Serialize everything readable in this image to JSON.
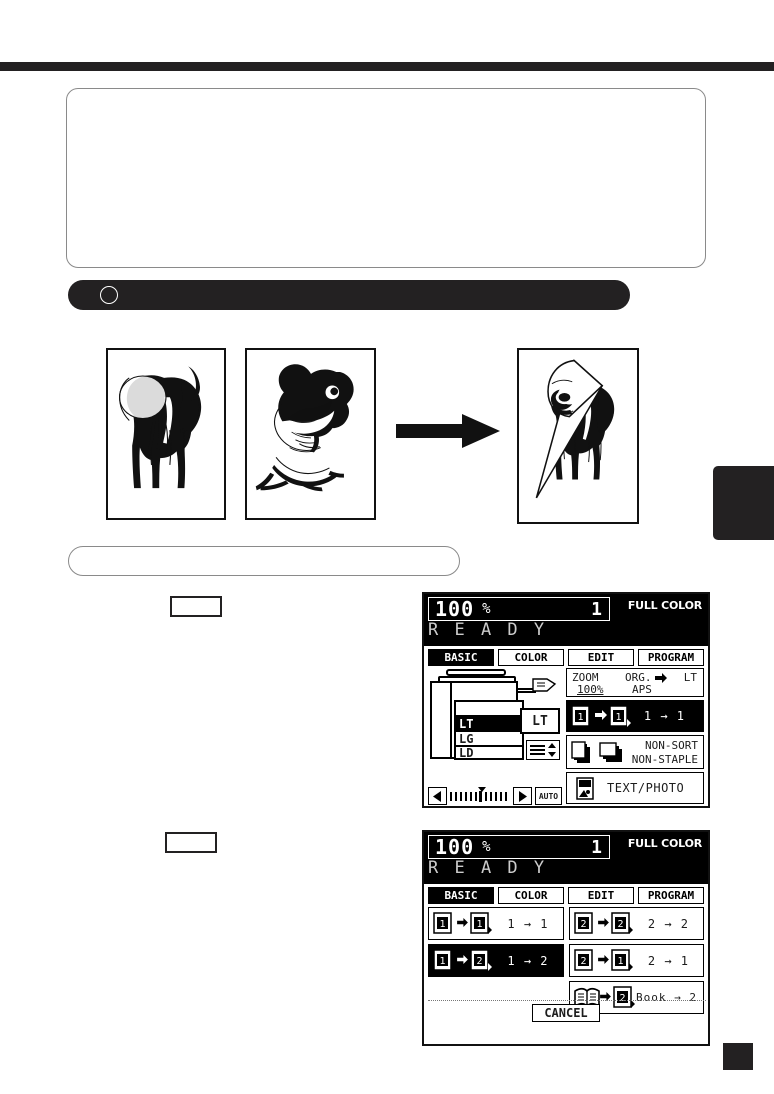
{
  "page": {
    "side_tab": "",
    "corner_marker": "",
    "intro_note": "",
    "section_heading": "",
    "procedure_heading": "",
    "step1_number": "",
    "step2_number": ""
  },
  "illustration": {
    "original_1": "elephant-original",
    "original_2": "dog-original",
    "arrow": "right-arrow",
    "result": "two-sided-copy-result"
  },
  "panel1": {
    "header": {
      "zoom_percent": "100",
      "percent_symbol": "%",
      "copies": "1",
      "color_mode": "FULL COLOR",
      "status": "R E A D Y"
    },
    "tabs": [
      {
        "label": "BASIC",
        "selected": true
      },
      {
        "label": "COLOR",
        "selected": false
      },
      {
        "label": "EDIT",
        "selected": false
      },
      {
        "label": "PROGRAM",
        "selected": false
      }
    ],
    "cassettes": [
      {
        "label": "",
        "selected": false
      },
      {
        "label": "LT",
        "selected": true
      },
      {
        "label": "LG",
        "selected": false
      },
      {
        "label": "LD",
        "selected": false
      }
    ],
    "current_paper": "LT",
    "density": {
      "auto_label": "AUTO"
    },
    "zoom_box": {
      "zoom_label": "ZOOM",
      "zoom_value": "100%",
      "org_label": "ORG.",
      "aps_label": "APS",
      "paper_label": "LT"
    },
    "duplex_button": {
      "label": "1 → 1",
      "selected": true
    },
    "finishing_button": {
      "line1": "NON-SORT",
      "line2": "NON-STAPLE"
    },
    "original_mode_button": {
      "label": "TEXT/PHOTO"
    }
  },
  "panel2": {
    "header": {
      "zoom_percent": "100",
      "percent_symbol": "%",
      "copies": "1",
      "color_mode": "FULL COLOR",
      "status": "R E A D Y"
    },
    "tabs": [
      {
        "label": "BASIC",
        "selected": true
      },
      {
        "label": "COLOR",
        "selected": false
      },
      {
        "label": "EDIT",
        "selected": false
      },
      {
        "label": "PROGRAM",
        "selected": false
      }
    ],
    "left_options": [
      {
        "label": "1 → 1",
        "selected": false
      },
      {
        "label": "1 → 2",
        "selected": true
      }
    ],
    "right_options": [
      {
        "label": "2 → 2",
        "selected": false
      },
      {
        "label": "2 → 1",
        "selected": false
      },
      {
        "label": "Book → 2",
        "selected": false
      }
    ],
    "cancel_label": "CANCEL"
  }
}
